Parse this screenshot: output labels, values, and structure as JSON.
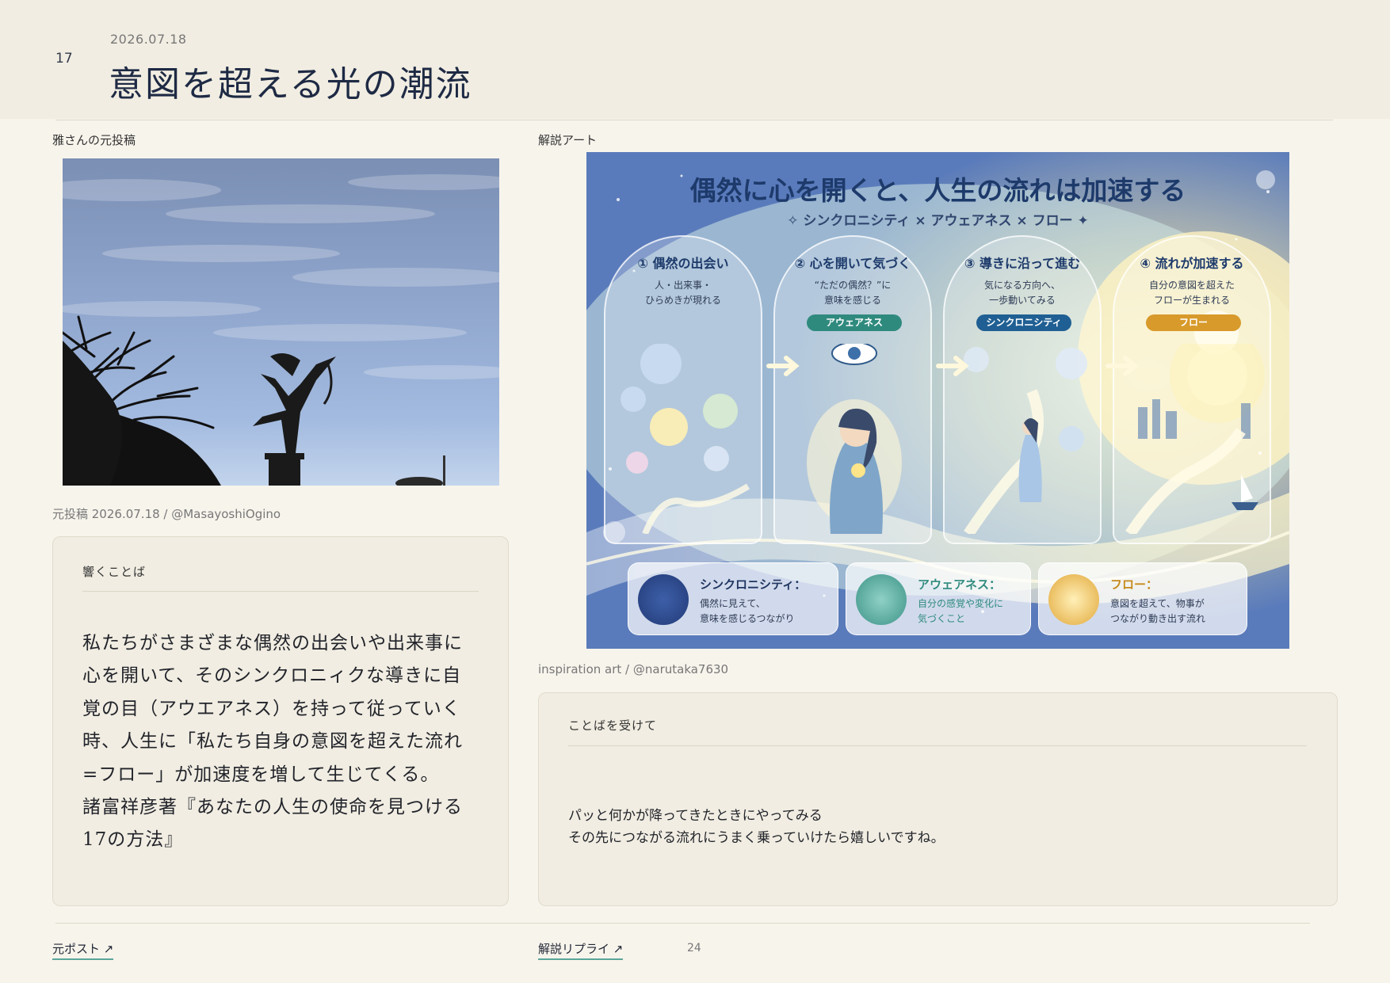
{
  "header": {
    "page_number": "17",
    "date": "2026.07.18",
    "title": "意図を超える光の潮流"
  },
  "left": {
    "section_label": "雅さんの元投稿",
    "photo_caption": "元投稿 2026.07.18 / @MasayoshiOgino",
    "quote_card": {
      "label": "響くことば",
      "lines": [
        "私たちがさまざまな偶然の出会いや出来事に",
        "心を開いて、そのシンクロニィクな導きに自",
        "覚の目（アウエアネス）を持って従っていく",
        "時、人生に「私たち自身の意図を超えた流れ",
        "=フロー」が加速度を増して生じてくる。",
        "諸富祥彦著『あなたの人生の使命を見つける",
        "17の方法』"
      ]
    }
  },
  "right": {
    "section_label": "解説アート",
    "art": {
      "title": "偶然に心を開くと、人生の流れは加速する",
      "subtitle": "✧ シンクロニシティ × アウェアネス × フロー ✦",
      "panels": [
        {
          "head": "① 偶然の出会い",
          "line1": "人・出来事・",
          "line2": "ひらめきが現れる",
          "badge": ""
        },
        {
          "head": "② 心を開いて気づく",
          "line1": "“ただの偶然？”に",
          "line2": "意味を感じる",
          "badge": "アウェアネス"
        },
        {
          "head": "③ 導きに沿って進む",
          "line1": "気になる方向へ、",
          "line2": "一歩動いてみる",
          "badge": "シンクロニシティ"
        },
        {
          "head": "④ 流れが加速する",
          "line1": "自分の意図を超えた",
          "line2": "フローが生まれる",
          "badge": "フロー"
        }
      ],
      "definitions": [
        {
          "title": "シンクロニシティ：",
          "line1": "偶然に見えて、",
          "line2": "意味を感じるつながり"
        },
        {
          "title": "アウェアネス：",
          "line1": "自分の感覚や変化に",
          "line2": "気づくこと"
        },
        {
          "title": "フロー：",
          "line1": "意図を超えて、物事が",
          "line2": "つながり動き出す流れ"
        }
      ],
      "colors": {
        "awareness": "#2f8a7e",
        "synchronicity": "#1f5f93",
        "flow": "#d89a2b"
      }
    },
    "art_caption": "inspiration art / @narutaka7630",
    "reply_card": {
      "label": "ことばを受けて",
      "lines": [
        "パッと何かが降ってきたときにやってみる",
        "その先につながる流れにうまく乗っていけたら嬉しいですね。"
      ]
    }
  },
  "footer": {
    "original_post_link": "元ポスト ↗",
    "reply_link": "解説リプライ ↗",
    "count": "24"
  }
}
